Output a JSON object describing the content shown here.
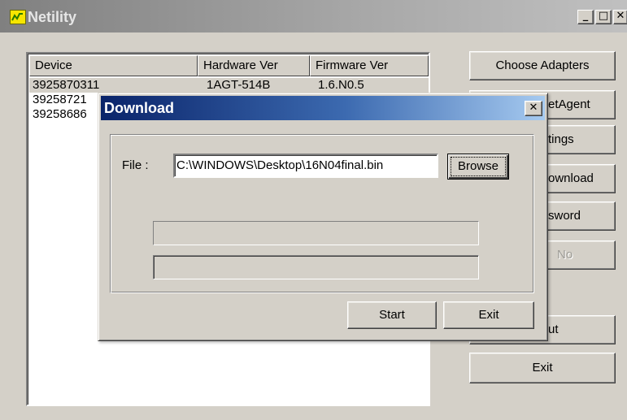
{
  "window": {
    "title": "Netility",
    "icons": [
      "app-icon",
      "minimize-icon",
      "maximize-icon",
      "close-icon"
    ]
  },
  "device_list": {
    "columns": [
      "Device",
      "Hardware Ver",
      "Firmware Ver"
    ],
    "rows": [
      {
        "device": "3925870311",
        "hardware": "1AGT-514B",
        "firmware": "1.6.N0.5"
      },
      {
        "device": "39258721",
        "hardware": "",
        "firmware": ""
      },
      {
        "device": "39258686",
        "hardware": "",
        "firmware": ""
      }
    ],
    "selected_row": 0
  },
  "side_buttons": [
    {
      "label": "Choose Adapters",
      "enabled": true
    },
    {
      "label": "etAgent",
      "enabled": true
    },
    {
      "label": "tings",
      "enabled": true
    },
    {
      "label": "ownload",
      "enabled": true
    },
    {
      "label": "sword",
      "enabled": true
    },
    {
      "label": "No",
      "enabled": false
    },
    {
      "label": "ut",
      "enabled": true
    },
    {
      "label": "Exit",
      "enabled": true
    }
  ],
  "download_dialog": {
    "title": "Download",
    "close_symbol": "✕",
    "file_label": "File :",
    "file_value": "C:\\WINDOWS\\Desktop\\16N04final.bin",
    "browse_label": "Browse",
    "progress": [
      0,
      0
    ],
    "start_label": "Start",
    "exit_label": "Exit"
  }
}
